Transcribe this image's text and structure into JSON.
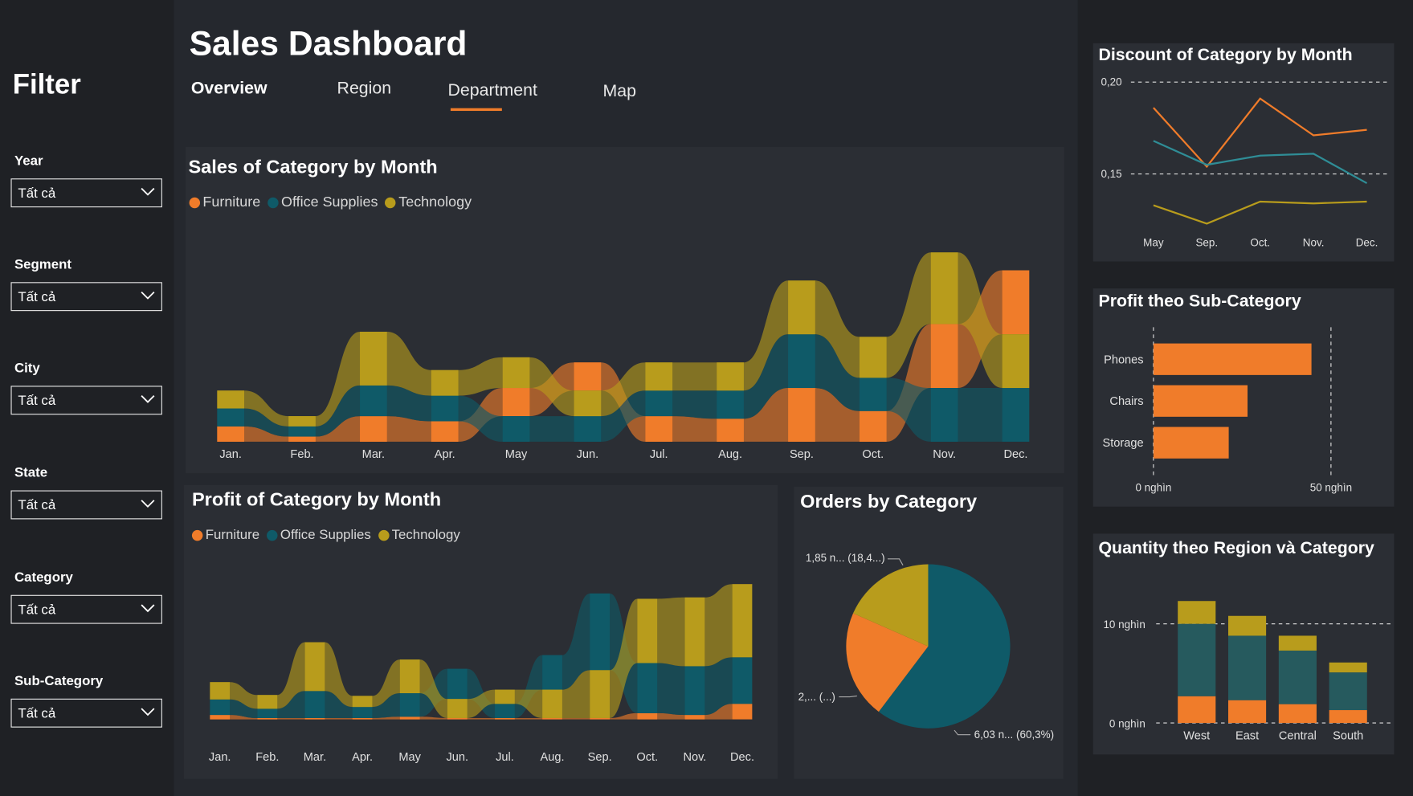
{
  "header": {
    "title": "Sales Dashboard"
  },
  "tabs": [
    {
      "label": "Overview"
    },
    {
      "label": "Region"
    },
    {
      "label": "Department"
    },
    {
      "label": "Map"
    }
  ],
  "filter": {
    "title": "Filter",
    "items": [
      {
        "label": "Year",
        "value": "Tất cả"
      },
      {
        "label": "Segment",
        "value": "Tất cả"
      },
      {
        "label": "City",
        "value": "Tất cả"
      },
      {
        "label": "State",
        "value": "Tất cả"
      },
      {
        "label": "Category",
        "value": "Tất cả"
      },
      {
        "label": "Sub-Category",
        "value": "Tất cả"
      }
    ]
  },
  "colors": {
    "furniture": "#f07c2a",
    "office_supplies": "#0f5a68",
    "technology": "#b89c1c",
    "grid": "#e0e0e0"
  },
  "chart_data": [
    {
      "id": "sales",
      "type": "area",
      "title": "Sales of Category by Month",
      "legend": [
        "Furniture",
        "Office Supplies",
        "Technology"
      ],
      "categories": [
        "Jan.",
        "Feb.",
        "Mar.",
        "Apr.",
        "May",
        "Jun.",
        "Jul.",
        "Aug.",
        "Sep.",
        "Oct.",
        "Nov.",
        "Dec."
      ],
      "series": [
        {
          "name": "Furniture",
          "values": [
            6,
            2,
            10,
            8,
            11,
            11,
            10,
            9,
            21,
            12,
            25,
            25
          ]
        },
        {
          "name": "Office Supplies",
          "values": [
            7,
            4,
            12,
            10,
            10,
            10,
            10,
            11,
            21,
            13,
            21,
            21
          ]
        },
        {
          "name": "Technology",
          "values": [
            7,
            4,
            21,
            10,
            12,
            10,
            11,
            11,
            21,
            16,
            28,
            21
          ]
        }
      ]
    },
    {
      "id": "profit",
      "type": "area",
      "title": "Profit of Category by Month",
      "legend": [
        "Furniture",
        "Office Supplies",
        "Technology"
      ],
      "categories": [
        "Jan.",
        "Feb.",
        "Mar.",
        "Apr.",
        "May",
        "Jun.",
        "Jul.",
        "Aug.",
        "Sep.",
        "Oct.",
        "Nov.",
        "Dec."
      ],
      "series": [
        {
          "name": "Furniture",
          "values": [
            1,
            0.3,
            0.3,
            0.3,
            0.6,
            0.3,
            0.3,
            0.3,
            0.3,
            1.4,
            1.0,
            3.5
          ]
        },
        {
          "name": "Office Supplies",
          "values": [
            3.5,
            2.1,
            6.1,
            2.5,
            5.3,
            6.8,
            3.2,
            7.8,
            17.3,
            11.3,
            11.0,
            10.5
          ]
        },
        {
          "name": "Technology",
          "values": [
            3.9,
            3.1,
            11.0,
            2.5,
            7.6,
            4.3,
            3.2,
            6.4,
            10.8,
            14.5,
            15.5,
            16.5
          ]
        }
      ]
    },
    {
      "id": "orders",
      "type": "pie",
      "title": "Orders by Category",
      "labels": [
        "Office Supplies",
        "Furniture",
        "Technology"
      ],
      "values": [
        60.3,
        21.3,
        18.4
      ],
      "data_labels": [
        "6,03 n... (60,3%)",
        "2,... (...)",
        "1,85 n... (18,4...)"
      ]
    },
    {
      "id": "discount",
      "type": "line",
      "title": "Discount of Category by Month",
      "categories": [
        "May",
        "Sep.",
        "Oct.",
        "Nov.",
        "Dec."
      ],
      "yticks": [
        "0,20",
        "0,15"
      ],
      "ylim": [
        0.1,
        0.2
      ],
      "series": [
        {
          "name": "Furniture",
          "values": [
            0.186,
            0.154,
            0.191,
            0.171,
            0.174
          ]
        },
        {
          "name": "Office Supplies",
          "values": [
            0.168,
            0.155,
            0.16,
            0.161,
            0.145
          ]
        },
        {
          "name": "Technology",
          "values": [
            0.133,
            0.123,
            0.135,
            0.134,
            0.135
          ]
        }
      ]
    },
    {
      "id": "subcat",
      "type": "bar",
      "title": "Profit theo Sub-Category",
      "categories": [
        "Phones",
        "Chairs",
        "Storage"
      ],
      "values": [
        44500,
        26500,
        21200
      ],
      "xticks": [
        "0 nghìn",
        "50 nghìn"
      ],
      "xlim": [
        0,
        50000
      ]
    },
    {
      "id": "quantity",
      "type": "bar",
      "title": "Quantity theo Region và Category",
      "categories": [
        "West",
        "East",
        "Central",
        "South"
      ],
      "yticks": [
        "10 nghìn",
        "0 nghìn"
      ],
      "ylim": [
        0,
        10000
      ],
      "series": [
        {
          "name": "Furniture",
          "values": [
            2700,
            2300,
            1900,
            1300
          ]
        },
        {
          "name": "Office Supplies",
          "values": [
            7300,
            6500,
            5400,
            3800
          ]
        },
        {
          "name": "Technology",
          "values": [
            2300,
            2000,
            1500,
            1000
          ]
        }
      ]
    }
  ]
}
